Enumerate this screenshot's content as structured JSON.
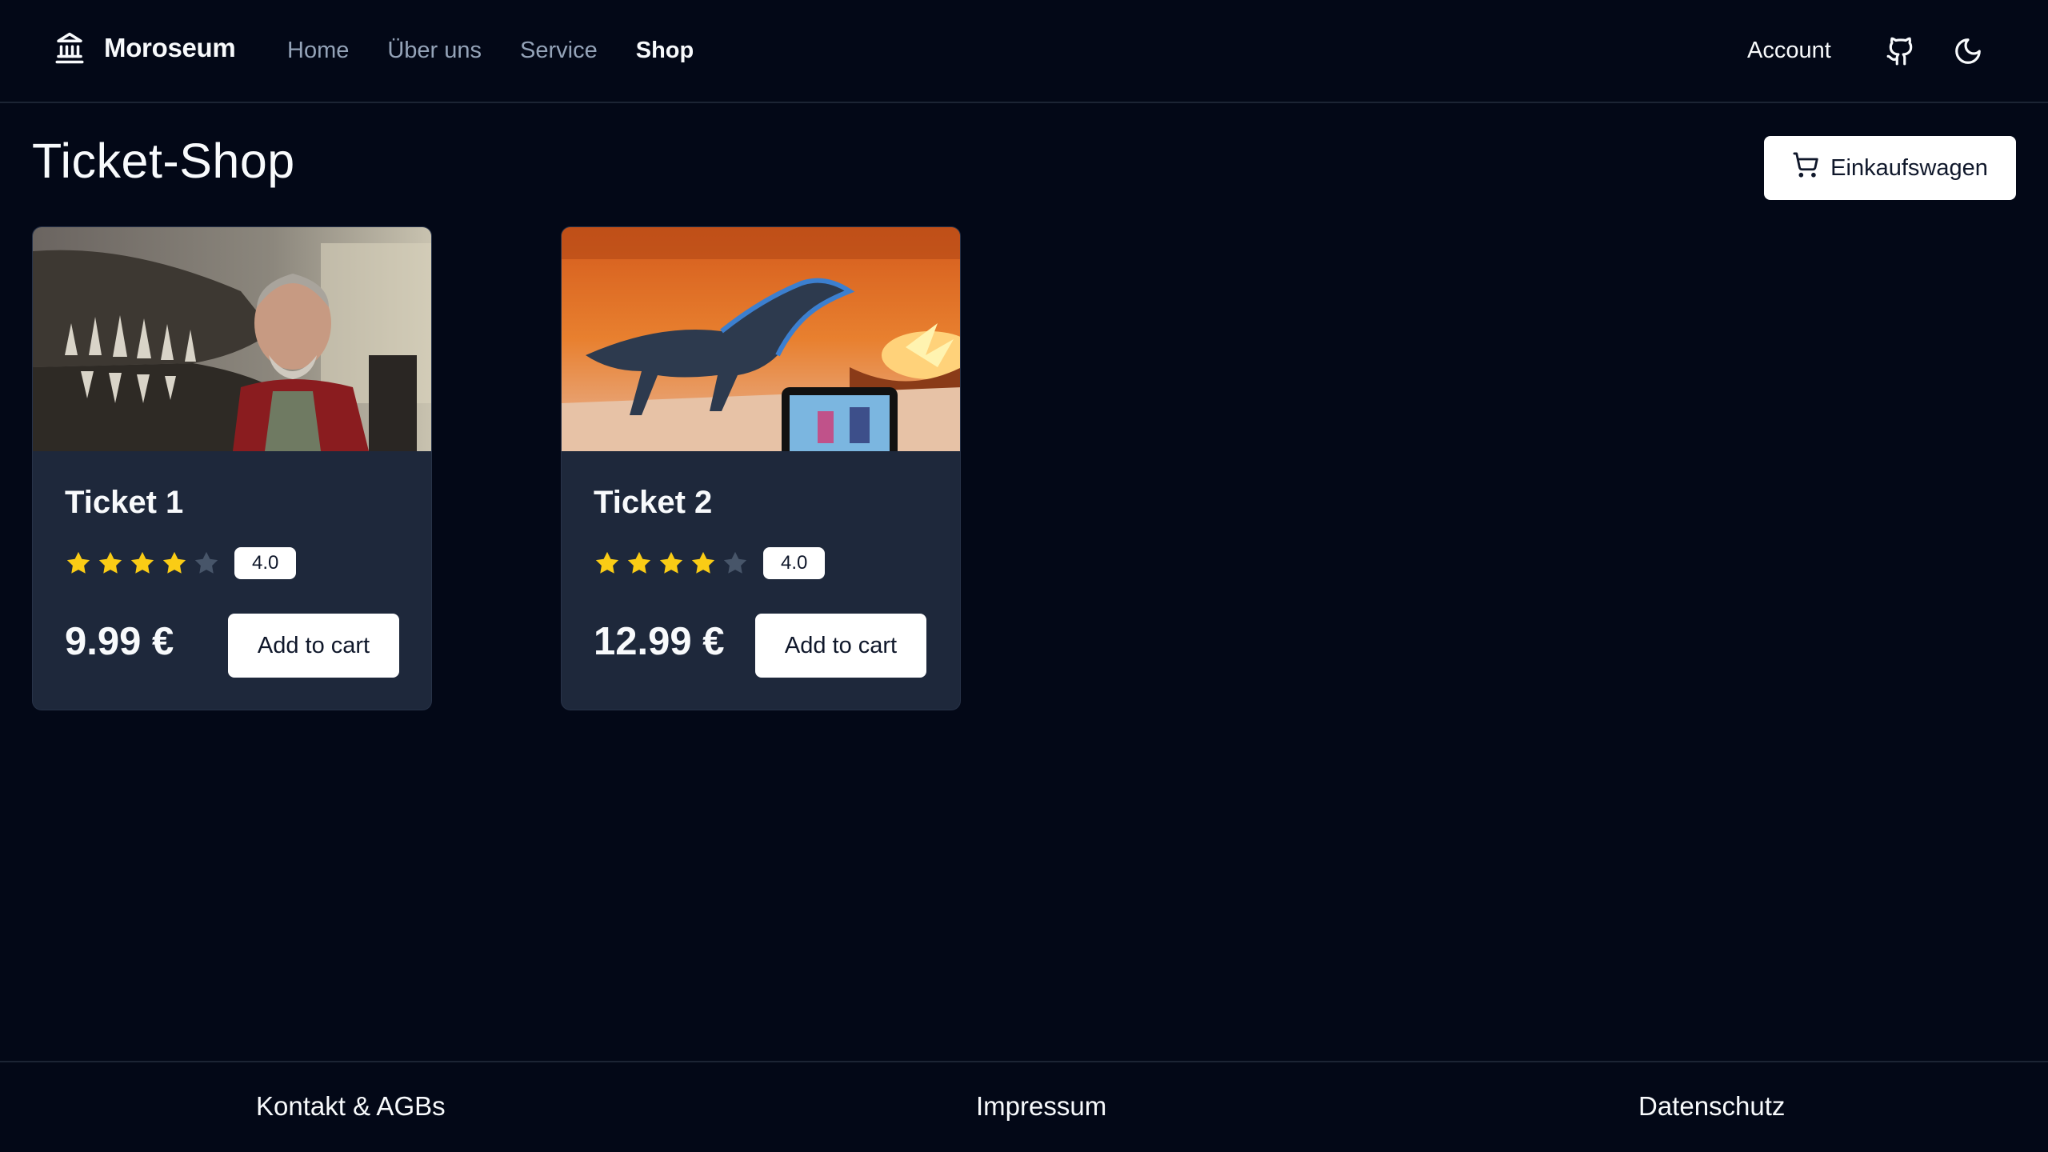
{
  "header": {
    "brand": "Moroseum",
    "nav": [
      {
        "label": "Home"
      },
      {
        "label": "Über uns"
      },
      {
        "label": "Service"
      },
      {
        "label": "Shop",
        "active": true
      }
    ],
    "account": "Account",
    "icons": [
      "museum-icon",
      "github-icon",
      "moon-icon"
    ]
  },
  "page": {
    "title": "Ticket-Shop",
    "cart_button": "Einkaufswagen"
  },
  "products": [
    {
      "title": "Ticket 1",
      "rating": 4,
      "rating_max": 5,
      "rating_label": "4.0",
      "price": "9.99 €",
      "button": "Add to cart"
    },
    {
      "title": "Ticket 2",
      "rating": 4,
      "rating_max": 5,
      "rating_label": "4.0",
      "price": "12.99 €",
      "button": "Add to cart"
    }
  ],
  "footer": {
    "links": [
      "Kontakt & AGBs",
      "Impressum",
      "Datenschutz"
    ]
  },
  "colors": {
    "background": "#030817",
    "card": "#1e283b",
    "star_filled": "#facc15",
    "star_empty": "#475569",
    "muted_text": "#94a3b8"
  }
}
